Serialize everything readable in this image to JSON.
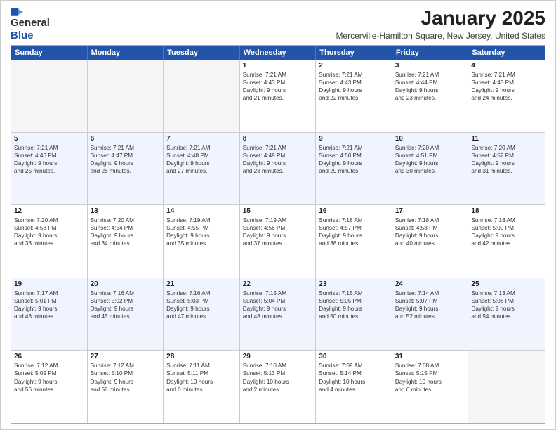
{
  "header": {
    "logo_line1": "General",
    "logo_line2": "Blue",
    "month_title": "January 2025",
    "location": "Mercerville-Hamilton Square, New Jersey, United States"
  },
  "days_of_week": [
    "Sunday",
    "Monday",
    "Tuesday",
    "Wednesday",
    "Thursday",
    "Friday",
    "Saturday"
  ],
  "weeks": [
    [
      {
        "day": "",
        "info": ""
      },
      {
        "day": "",
        "info": ""
      },
      {
        "day": "",
        "info": ""
      },
      {
        "day": "1",
        "info": "Sunrise: 7:21 AM\nSunset: 4:43 PM\nDaylight: 9 hours\nand 21 minutes."
      },
      {
        "day": "2",
        "info": "Sunrise: 7:21 AM\nSunset: 4:43 PM\nDaylight: 9 hours\nand 22 minutes."
      },
      {
        "day": "3",
        "info": "Sunrise: 7:21 AM\nSunset: 4:44 PM\nDaylight: 9 hours\nand 23 minutes."
      },
      {
        "day": "4",
        "info": "Sunrise: 7:21 AM\nSunset: 4:45 PM\nDaylight: 9 hours\nand 24 minutes."
      }
    ],
    [
      {
        "day": "5",
        "info": "Sunrise: 7:21 AM\nSunset: 4:46 PM\nDaylight: 9 hours\nand 25 minutes."
      },
      {
        "day": "6",
        "info": "Sunrise: 7:21 AM\nSunset: 4:47 PM\nDaylight: 9 hours\nand 26 minutes."
      },
      {
        "day": "7",
        "info": "Sunrise: 7:21 AM\nSunset: 4:48 PM\nDaylight: 9 hours\nand 27 minutes."
      },
      {
        "day": "8",
        "info": "Sunrise: 7:21 AM\nSunset: 4:49 PM\nDaylight: 9 hours\nand 28 minutes."
      },
      {
        "day": "9",
        "info": "Sunrise: 7:21 AM\nSunset: 4:50 PM\nDaylight: 9 hours\nand 29 minutes."
      },
      {
        "day": "10",
        "info": "Sunrise: 7:20 AM\nSunset: 4:51 PM\nDaylight: 9 hours\nand 30 minutes."
      },
      {
        "day": "11",
        "info": "Sunrise: 7:20 AM\nSunset: 4:52 PM\nDaylight: 9 hours\nand 31 minutes."
      }
    ],
    [
      {
        "day": "12",
        "info": "Sunrise: 7:20 AM\nSunset: 4:53 PM\nDaylight: 9 hours\nand 33 minutes."
      },
      {
        "day": "13",
        "info": "Sunrise: 7:20 AM\nSunset: 4:54 PM\nDaylight: 9 hours\nand 34 minutes."
      },
      {
        "day": "14",
        "info": "Sunrise: 7:19 AM\nSunset: 4:55 PM\nDaylight: 9 hours\nand 35 minutes."
      },
      {
        "day": "15",
        "info": "Sunrise: 7:19 AM\nSunset: 4:56 PM\nDaylight: 9 hours\nand 37 minutes."
      },
      {
        "day": "16",
        "info": "Sunrise: 7:18 AM\nSunset: 4:57 PM\nDaylight: 9 hours\nand 38 minutes."
      },
      {
        "day": "17",
        "info": "Sunrise: 7:18 AM\nSunset: 4:58 PM\nDaylight: 9 hours\nand 40 minutes."
      },
      {
        "day": "18",
        "info": "Sunrise: 7:18 AM\nSunset: 5:00 PM\nDaylight: 9 hours\nand 42 minutes."
      }
    ],
    [
      {
        "day": "19",
        "info": "Sunrise: 7:17 AM\nSunset: 5:01 PM\nDaylight: 9 hours\nand 43 minutes."
      },
      {
        "day": "20",
        "info": "Sunrise: 7:16 AM\nSunset: 5:02 PM\nDaylight: 9 hours\nand 45 minutes."
      },
      {
        "day": "21",
        "info": "Sunrise: 7:16 AM\nSunset: 5:03 PM\nDaylight: 9 hours\nand 47 minutes."
      },
      {
        "day": "22",
        "info": "Sunrise: 7:15 AM\nSunset: 5:04 PM\nDaylight: 9 hours\nand 48 minutes."
      },
      {
        "day": "23",
        "info": "Sunrise: 7:15 AM\nSunset: 5:05 PM\nDaylight: 9 hours\nand 50 minutes."
      },
      {
        "day": "24",
        "info": "Sunrise: 7:14 AM\nSunset: 5:07 PM\nDaylight: 9 hours\nand 52 minutes."
      },
      {
        "day": "25",
        "info": "Sunrise: 7:13 AM\nSunset: 5:08 PM\nDaylight: 9 hours\nand 54 minutes."
      }
    ],
    [
      {
        "day": "26",
        "info": "Sunrise: 7:12 AM\nSunset: 5:09 PM\nDaylight: 9 hours\nand 56 minutes."
      },
      {
        "day": "27",
        "info": "Sunrise: 7:12 AM\nSunset: 5:10 PM\nDaylight: 9 hours\nand 58 minutes."
      },
      {
        "day": "28",
        "info": "Sunrise: 7:11 AM\nSunset: 5:11 PM\nDaylight: 10 hours\nand 0 minutes."
      },
      {
        "day": "29",
        "info": "Sunrise: 7:10 AM\nSunset: 5:13 PM\nDaylight: 10 hours\nand 2 minutes."
      },
      {
        "day": "30",
        "info": "Sunrise: 7:09 AM\nSunset: 5:14 PM\nDaylight: 10 hours\nand 4 minutes."
      },
      {
        "day": "31",
        "info": "Sunrise: 7:08 AM\nSunset: 5:15 PM\nDaylight: 10 hours\nand 6 minutes."
      },
      {
        "day": "",
        "info": ""
      }
    ]
  ]
}
